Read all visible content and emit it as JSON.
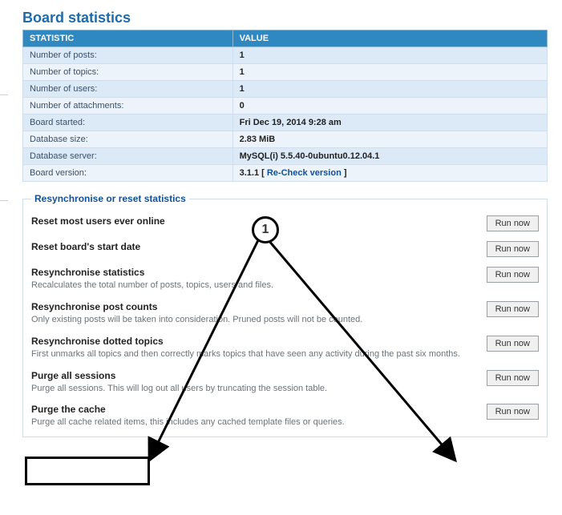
{
  "page_title": "Board statistics",
  "table": {
    "headers": {
      "stat": "STATISTIC",
      "value": "VALUE"
    },
    "rows": [
      {
        "label": "Number of posts:",
        "value": "1"
      },
      {
        "label": "Number of topics:",
        "value": "1"
      },
      {
        "label": "Number of users:",
        "value": "1"
      },
      {
        "label": "Number of attachments:",
        "value": "0"
      },
      {
        "label": "Board started:",
        "value": "Fri Dec 19, 2014 9:28 am"
      },
      {
        "label": "Database size:",
        "value": "2.83 MiB"
      },
      {
        "label": "Database server:",
        "value": "MySQL(i) 5.5.40-0ubuntu0.12.04.1"
      }
    ],
    "version_row": {
      "label": "Board version:",
      "version": "3.1.1",
      "link": "Re-Check version"
    }
  },
  "fieldset": {
    "legend": "Resynchronise or reset statistics",
    "actions": [
      {
        "title": "Reset most users ever online",
        "desc": "",
        "button": "Run now"
      },
      {
        "title": "Reset board's start date",
        "desc": "",
        "button": "Run now"
      },
      {
        "title": "Resynchronise statistics",
        "desc": "Recalculates the total number of posts, topics, users and files.",
        "button": "Run now"
      },
      {
        "title": "Resynchronise post counts",
        "desc": "Only existing posts will be taken into consideration. Pruned posts will not be counted.",
        "button": "Run now"
      },
      {
        "title": "Resynchronise dotted topics",
        "desc": "First unmarks all topics and then correctly marks topics that have seen any activity during the past six months.",
        "button": "Run now"
      },
      {
        "title": "Purge all sessions",
        "desc": "Purge all sessions. This will log out all users by truncating the session table.",
        "button": "Run now"
      },
      {
        "title": "Purge the cache",
        "desc": "Purge all cache related items, this includes any cached template files or queries.",
        "button": "Run now"
      }
    ]
  },
  "annotation": {
    "marker": "1"
  }
}
